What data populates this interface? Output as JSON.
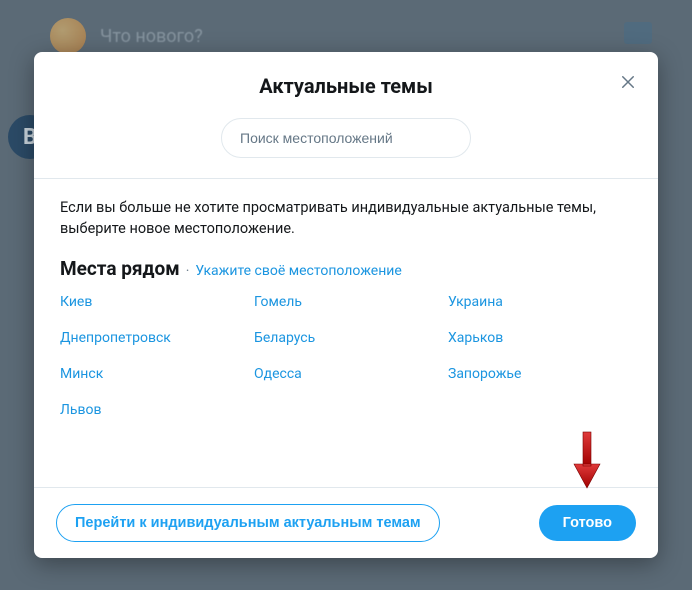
{
  "background": {
    "prompt_text": "Что нового?",
    "circle_letter": "В"
  },
  "modal": {
    "title": "Актуальные темы",
    "search_placeholder": "Поиск местоположений",
    "description": "Если вы больше не хотите просматривать индивидуальные актуальные темы, выберите новое местоположение.",
    "nearby": {
      "title": "Места рядом",
      "separator": "·",
      "link": "Укажите своё местоположение",
      "items": [
        "Киев",
        "Гомель",
        "Украина",
        "Днепропетровск",
        "Беларусь",
        "Харьков",
        "Минск",
        "Одесса",
        "Запорожье",
        "Львов"
      ]
    },
    "footer": {
      "secondary": "Перейти к индивидуальным актуальным темам",
      "primary": "Готово"
    }
  }
}
